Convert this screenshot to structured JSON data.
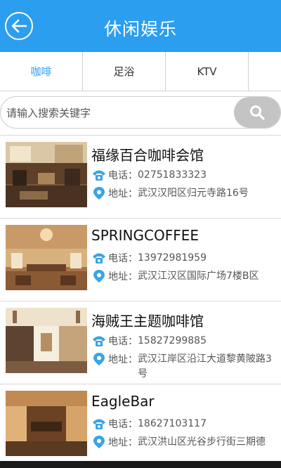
{
  "header": {
    "title": "休闲娱乐"
  },
  "tabs": [
    {
      "label": "咖啡"
    },
    {
      "label": "足浴"
    },
    {
      "label": "KTV"
    }
  ],
  "search": {
    "placeholder": "请输入搜索关键字"
  },
  "labels": {
    "phone": "电话：",
    "address": "地址："
  },
  "items": [
    {
      "name": "福缘百合咖啡会馆",
      "phone": "02751833323",
      "address": "武汉汉阳区归元寺路16号"
    },
    {
      "name": "SPRINGCOFFEE",
      "phone": "13972981959",
      "address": "武汉江汉区国际广场7楼B区"
    },
    {
      "name": "海贼王主题咖啡馆",
      "phone": "15827299885",
      "address": "武汉江岸区沿江大道黎黄陂路3号"
    },
    {
      "name": "EagleBar",
      "phone": "18627103117",
      "address": "武汉洪山区光谷步行街三期德"
    }
  ],
  "colors": {
    "accent": "#2b9ef0",
    "icon": "#3aa4e6",
    "search_button": "#c4c4c4"
  }
}
